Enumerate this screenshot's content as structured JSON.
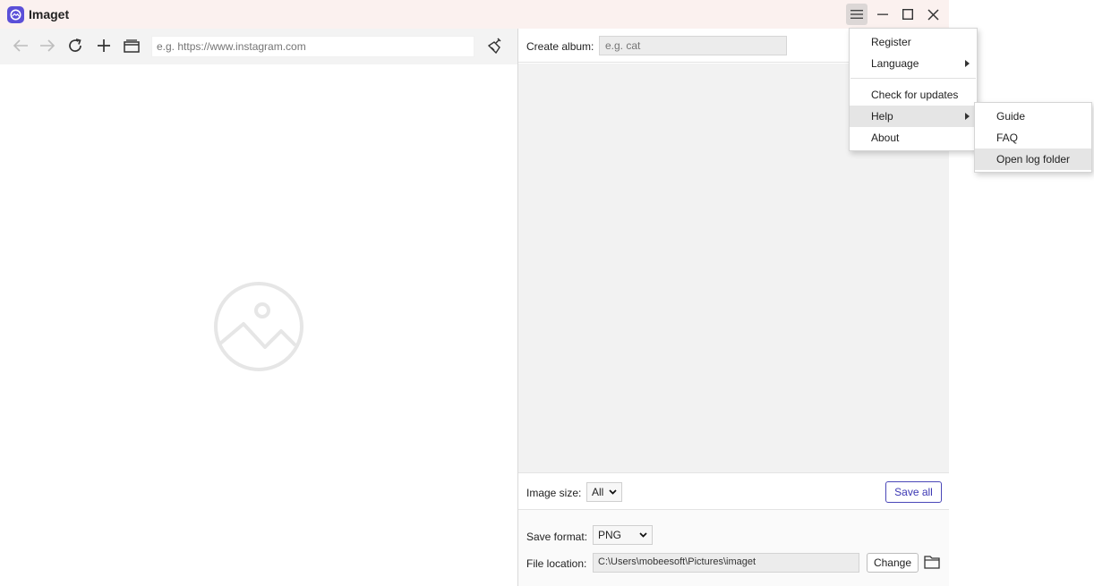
{
  "app": {
    "title": "Imaget"
  },
  "browser": {
    "url_placeholder": "e.g. https://www.instagram.com"
  },
  "panel": {
    "album_label": "Create album:",
    "album_placeholder": "e.g. cat",
    "image_size_label": "Image size:",
    "image_size_value": "All",
    "save_all_label": "Save all",
    "save_format_label": "Save format:",
    "save_format_value": "PNG",
    "file_location_label": "File location:",
    "file_location_value": "C:\\Users\\mobeesoft\\Pictures\\imaget",
    "change_label": "Change"
  },
  "menu": {
    "items": [
      {
        "label": "Register"
      },
      {
        "label": "Language",
        "submenu": true
      },
      {
        "label": "Check for updates"
      },
      {
        "label": "Help",
        "submenu": true,
        "highlighted": true
      },
      {
        "label": "About"
      }
    ]
  },
  "help_submenu": {
    "items": [
      {
        "label": "Guide"
      },
      {
        "label": "FAQ"
      },
      {
        "label": "Open log folder",
        "highlighted": true
      }
    ]
  },
  "colors": {
    "accent": "#4a47b8",
    "logo": "#5b4fd8",
    "titlebar": "#fbf1ef"
  },
  "icons": [
    "back-icon",
    "forward-icon",
    "reload-icon",
    "plus-icon",
    "tab-icon",
    "clean-icon",
    "image-placeholder-icon",
    "folder-icon",
    "hamburger-icon",
    "minimize-icon",
    "maximize-icon",
    "close-icon"
  ]
}
